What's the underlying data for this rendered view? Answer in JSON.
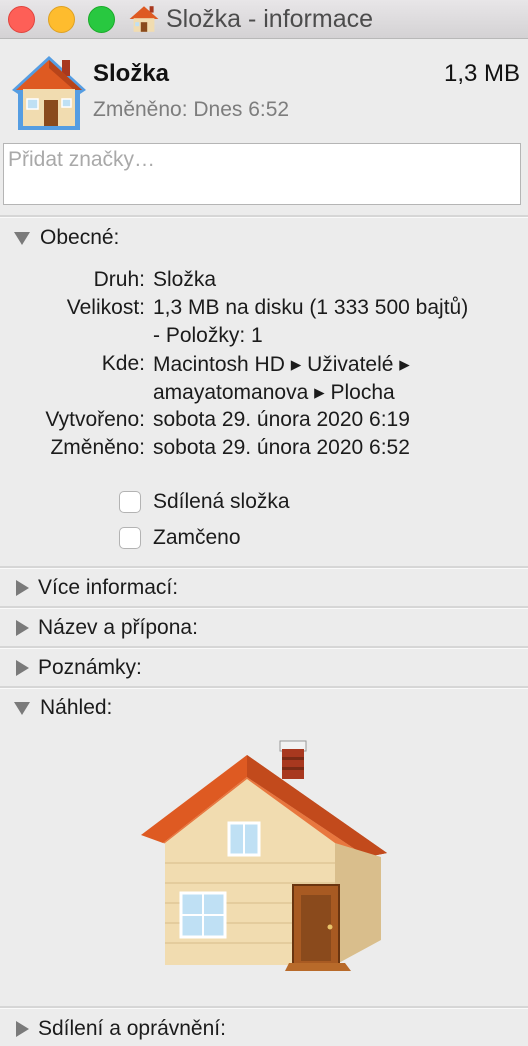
{
  "window": {
    "title": "Složka - informace",
    "controls": [
      "close",
      "minimize",
      "zoom"
    ]
  },
  "header": {
    "icon": "home-folder-icon",
    "name": "Složka",
    "size": "1,3 MB",
    "modified": "Změněno: Dnes 6:52"
  },
  "tags": {
    "placeholder": "Přidat značky…",
    "value": ""
  },
  "general": {
    "label": "Obecné:",
    "expanded": true,
    "rows": [
      {
        "key": "Druh:",
        "lines": [
          "Složka"
        ]
      },
      {
        "key": "Velikost:",
        "lines": [
          "1,3 MB na disku (1 333 500 bajtů)",
          "- Položky: 1"
        ]
      },
      {
        "key": "Kde:",
        "lines": [
          "Macintosh HD ▸ Uživatelé ▸",
          "amayatomanova ▸ Plocha"
        ]
      },
      {
        "key": "Vytvořeno:",
        "lines": [
          "sobota 29. února 2020 6:19"
        ]
      },
      {
        "key": "Změněno:",
        "lines": [
          "sobota 29. února 2020 6:52"
        ]
      }
    ],
    "shared_folder": {
      "label": "Sdílená složka",
      "checked": false
    },
    "locked": {
      "label": "Zamčeno",
      "checked": false
    }
  },
  "sections": {
    "more_info": {
      "label": "Více informací:",
      "expanded": false
    },
    "name_ext": {
      "label": "Název a přípona:",
      "expanded": false
    },
    "comments": {
      "label": "Poznámky:",
      "expanded": false
    },
    "preview": {
      "label": "Náhled:",
      "expanded": true
    },
    "sharing": {
      "label": "Sdílení a oprávnění:",
      "expanded": false
    }
  },
  "colors": {
    "roof": "#d9531e",
    "wall": "#f1dcb0",
    "door": "#8a4a1c",
    "window": "#bfe0f4",
    "accent_blue": "#3b8fe0"
  }
}
